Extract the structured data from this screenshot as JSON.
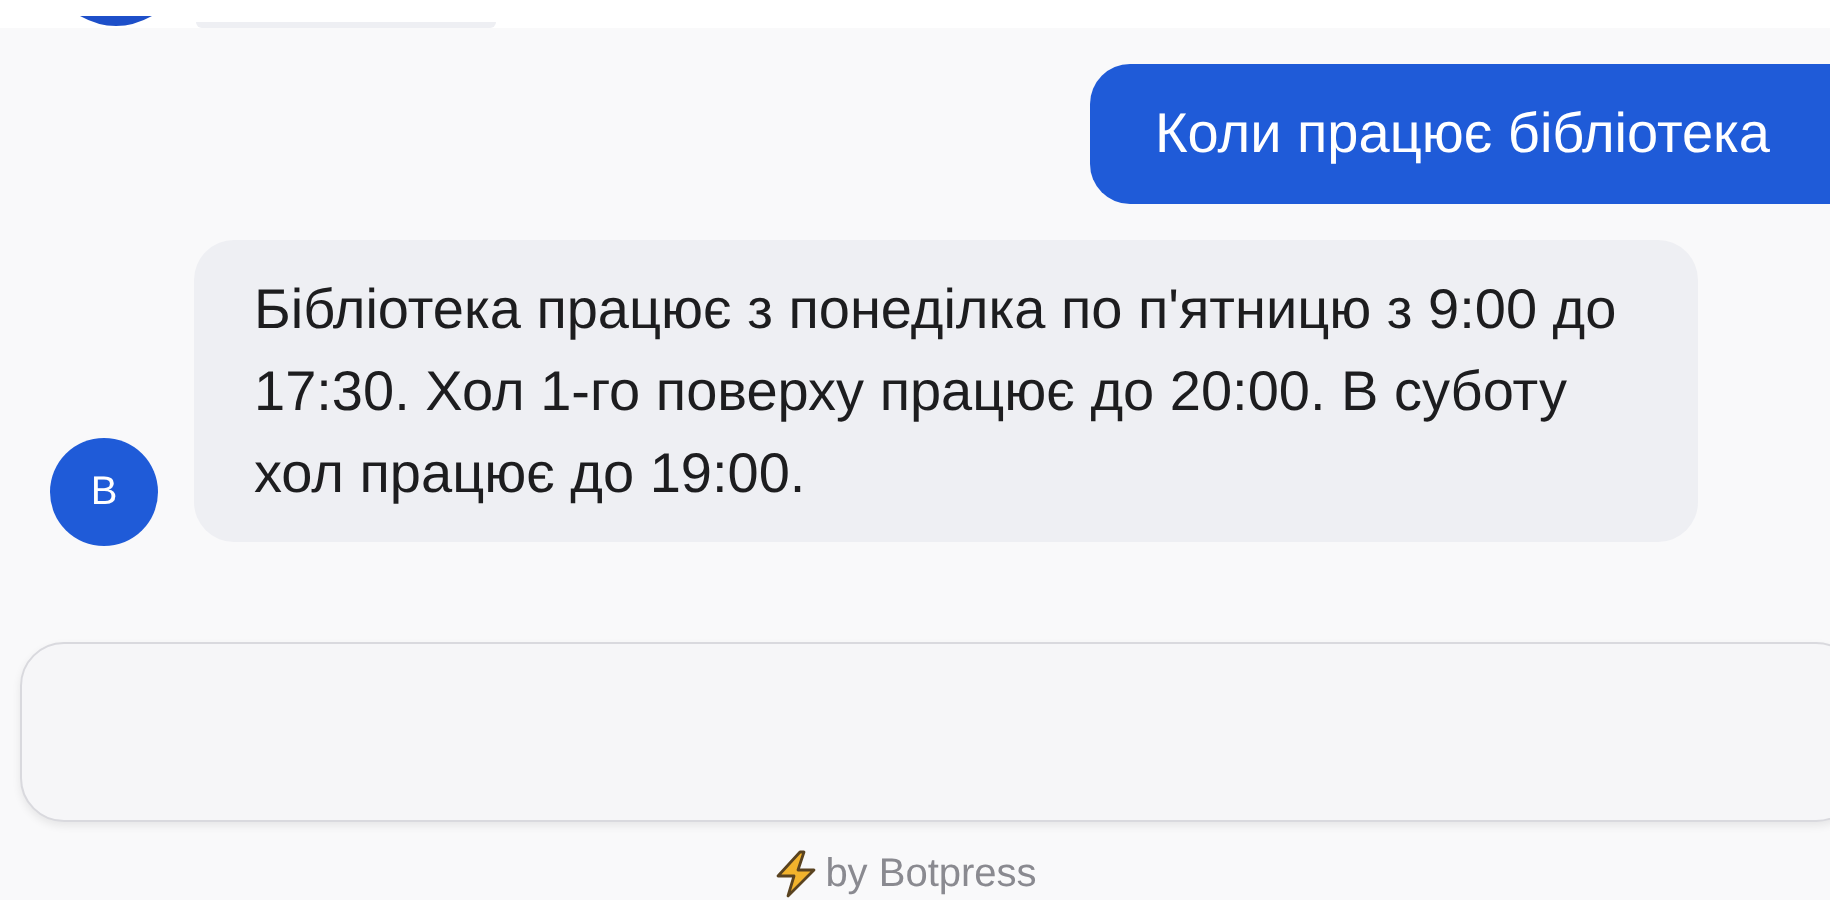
{
  "messages": [
    {
      "kind": "user",
      "text": "Коли працює бібліотека"
    },
    {
      "kind": "bot",
      "avatar": "B",
      "text": "Бібліотека працює з понеділка по п'ятницю з 9:00 до 17:30. Хол 1-го поверху працює до 20:00. В суботу хол працює до 19:00."
    }
  ],
  "footer": {
    "text": "by Botpress"
  }
}
